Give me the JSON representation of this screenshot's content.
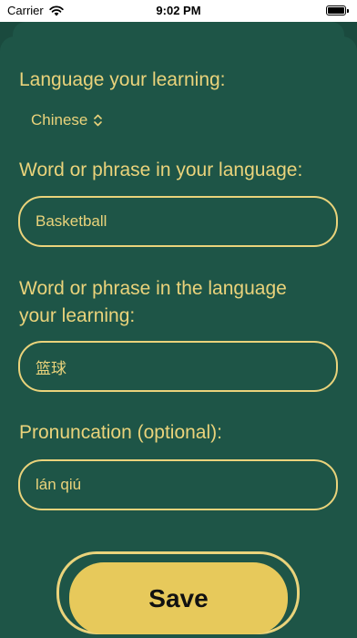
{
  "status_bar": {
    "carrier": "Carrier",
    "time": "9:02 PM"
  },
  "form": {
    "language_label": "Language your learning:",
    "language_value": "Chinese",
    "native_label": "Word or phrase in your language:",
    "native_value": "Basketball",
    "target_label_line1": "Word or phrase in the language",
    "target_label_line2": "your learning:",
    "target_value": "篮球",
    "pronunciation_label": "Pronuncation (optional):",
    "pronunciation_value": "lán qiú",
    "save_label": "Save"
  },
  "colors": {
    "background": "#1a4a3e",
    "accent": "#ead37b",
    "button": "#e7c95b"
  },
  "icons": {
    "wifi": "wifi-icon",
    "battery": "battery-icon",
    "picker": "chevron-up-down-icon"
  }
}
